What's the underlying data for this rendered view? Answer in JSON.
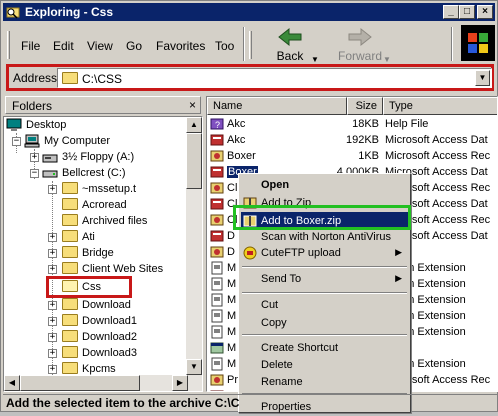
{
  "window": {
    "title": "Exploring - Css",
    "controls": [
      "_",
      "□",
      "×"
    ]
  },
  "menu": [
    "File",
    "Edit",
    "View",
    "Go",
    "Favorites",
    "Too"
  ],
  "toolbar": {
    "back_label": "Back",
    "forward_label": "Forward"
  },
  "address": {
    "label": "Address",
    "value": "C:\\CSS"
  },
  "folders": {
    "header": "Folders",
    "tree": [
      {
        "label": "Desktop",
        "icon": "desktop-icon"
      },
      {
        "label": "My Computer",
        "icon": "computer-icon"
      },
      {
        "label": "3½ Floppy (A:)",
        "icon": "floppy-icon"
      },
      {
        "label": "Bellcrest (C:)",
        "icon": "drive-icon"
      },
      {
        "label": "~mssetup.t",
        "icon": "folder-icon"
      },
      {
        "label": "Acroread",
        "icon": "folder-icon"
      },
      {
        "label": "Archived files",
        "icon": "folder-icon"
      },
      {
        "label": "Ati",
        "icon": "folder-icon"
      },
      {
        "label": "Bridge",
        "icon": "folder-icon"
      },
      {
        "label": "Client Web Sites",
        "icon": "folder-icon"
      },
      {
        "label": "Css",
        "icon": "open-folder-icon"
      },
      {
        "label": "Download",
        "icon": "folder-icon"
      },
      {
        "label": "Download1",
        "icon": "folder-icon"
      },
      {
        "label": "Download2",
        "icon": "folder-icon"
      },
      {
        "label": "Download3",
        "icon": "folder-icon"
      },
      {
        "label": "Kpcms",
        "icon": "folder-icon"
      }
    ]
  },
  "files": {
    "columns": [
      "Name",
      "Size",
      "Type"
    ],
    "rows": [
      {
        "name": "Akc",
        "size": "18KB",
        "type": "Help File",
        "icon": "help-file-icon"
      },
      {
        "name": "Akc",
        "size": "192KB",
        "type": "Microsoft Access Dat",
        "icon": "access-db-icon"
      },
      {
        "name": "Boxer",
        "size": "1KB",
        "type": "Microsoft Access Rec",
        "icon": "access-app-icon"
      },
      {
        "name": "Boxer",
        "size": "4,000KB",
        "type": "Microsoft Access Dat",
        "icon": "access-db-icon"
      },
      {
        "name": "Cl",
        "size": "",
        "type": "Microsoft Access Rec",
        "icon": "access-app-icon"
      },
      {
        "name": "Cl",
        "size": "",
        "type": "Microsoft Access Dat",
        "icon": "access-db-icon"
      },
      {
        "name": "Cl",
        "size": "",
        "type": "Microsoft Access Rec",
        "icon": "access-app-icon"
      },
      {
        "name": "D",
        "size": "",
        "type": "Microsoft Access Dat",
        "icon": "access-db-icon"
      },
      {
        "name": "D",
        "size": "",
        "type": "",
        "icon": "access-app-icon"
      },
      {
        "name": "M",
        "size": "",
        "type": "cation Extension",
        "icon": "dll-icon"
      },
      {
        "name": "M",
        "size": "",
        "type": "cation Extension",
        "icon": "dll-icon"
      },
      {
        "name": "M",
        "size": "",
        "type": "cation Extension",
        "icon": "dll-icon"
      },
      {
        "name": "M",
        "size": "",
        "type": "cation Extension",
        "icon": "dll-icon"
      },
      {
        "name": "M",
        "size": "",
        "type": "cation Extension",
        "icon": "dll-icon"
      },
      {
        "name": "M",
        "size": "",
        "type": "",
        "icon": "exe-icon"
      },
      {
        "name": "M",
        "size": "",
        "type": "cation Extension",
        "icon": "dll-icon"
      },
      {
        "name": "Pr",
        "size": "",
        "type": "Microsoft Access Rec",
        "icon": "access-app-icon"
      },
      {
        "name": "Pr",
        "size": "",
        "type": "Microsoft Access Dat",
        "icon": "access-db-icon"
      },
      {
        "name": "Pr",
        "size": "",
        "type": "Microsoft Access Rec",
        "icon": "access-app-icon"
      }
    ]
  },
  "context_menu": {
    "items": [
      {
        "label": "Open",
        "bold": true
      },
      {
        "label": "Add to Zip",
        "icon": "zip-icon"
      },
      {
        "label": "Add to Boxer.zip",
        "icon": "zip-icon",
        "highlighted": true
      },
      {
        "label": "Scan with Norton AntiVirus"
      },
      {
        "label": "CuteFTP upload",
        "icon": "ftp-icon",
        "submenu": true
      },
      {
        "label": "Send To",
        "submenu": true
      },
      {
        "label": "Cut"
      },
      {
        "label": "Copy"
      },
      {
        "label": "Create Shortcut"
      },
      {
        "label": "Delete"
      },
      {
        "label": "Rename"
      },
      {
        "label": "Properties"
      }
    ]
  },
  "status": {
    "text": "Add the selected item to the archive C:\\C"
  },
  "colors": {
    "titlebar": "#0a246a",
    "highlight_red": "#c81818",
    "highlight_green": "#22c022",
    "selection": "#0a246a"
  }
}
